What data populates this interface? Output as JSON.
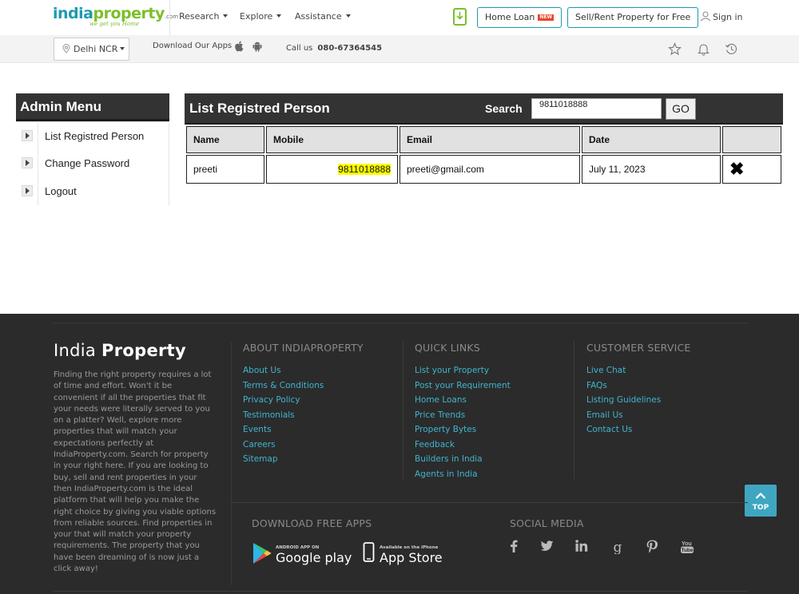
{
  "header": {
    "logo": {
      "india": "india",
      "property": "property",
      "com": ".com",
      "tagline": "we get you Home"
    },
    "nav": [
      {
        "label": "Research"
      },
      {
        "label": "Explore"
      },
      {
        "label": "Assistance"
      }
    ],
    "home_loan": {
      "label": "Home Loan",
      "badge": "NEW"
    },
    "sell_rent": "Sell/Rent Property for Free",
    "sign_in": "Sign in"
  },
  "subbar": {
    "city": "Delhi NCR",
    "apps_text": "Download Our Apps",
    "call_label": "Call us",
    "call_number": "080-67364545"
  },
  "admin_menu": {
    "title": "Admin Menu",
    "items": [
      {
        "label": "List Registred Person"
      },
      {
        "label": "Change Password"
      },
      {
        "label": "Logout"
      }
    ]
  },
  "registered": {
    "title": "List Registred Person",
    "search_label": "Search",
    "search_value": "9811018888",
    "go_label": "GO",
    "columns": [
      "Name",
      "Mobile",
      "Email",
      "Date",
      ""
    ],
    "rows": [
      {
        "name": "preeti",
        "mobile": "9811018888",
        "email": "preeti@gmail.com",
        "date": "July 11, 2023",
        "delete": "✖"
      }
    ]
  },
  "footer": {
    "brand_light": "India",
    "brand_bold": "Property",
    "description": "Finding the right property requires a lot of time and effort. Won't it be convenient if all the properties that fit your needs were literally served to you on a platter? Well, explore more properties that will match your expectations perfectly at IndiaProperty.com. Search for property in your right here. If you are looking to buy, sell and rent properties in your then IndiaProperty.com is the ideal platform that will help you make the right choice by giving you viable options from reliable sources. Find properties in your that will match your property requirements. The property that you have been dreaming of is now just a click away!",
    "about": {
      "heading": "ABOUT INDIAPROPERTY",
      "links": [
        "About Us",
        "Terms & Conditions",
        "Privacy Policy",
        "Testimonials",
        "Events",
        "Careers",
        "Sitemap"
      ]
    },
    "quick": {
      "heading": "QUICK LINKS",
      "links": [
        "List your Property",
        "Post your Requirement",
        "Home Loans",
        "Price Trends",
        "Property Bytes",
        "Feedback",
        "Builders in India",
        "Agents in India"
      ]
    },
    "customer": {
      "heading": "CUSTOMER SERVICE",
      "links": [
        "Live Chat",
        "FAQs",
        "Listing Guidelines",
        "Email Us",
        "Contact Us"
      ]
    },
    "apps_heading": "DOWNLOAD FREE APPS",
    "google": {
      "small": "ANDROID APP ON",
      "big": "Google play"
    },
    "apple": {
      "small": "Available on the iPhone",
      "big": "App Store"
    },
    "social_heading": "SOCIAL MEDIA",
    "social": [
      "facebook-icon",
      "twitter-icon",
      "linkedin-icon",
      "google-plus-icon",
      "pinterest-icon",
      "youtube-icon"
    ],
    "top_label": "TOP"
  }
}
